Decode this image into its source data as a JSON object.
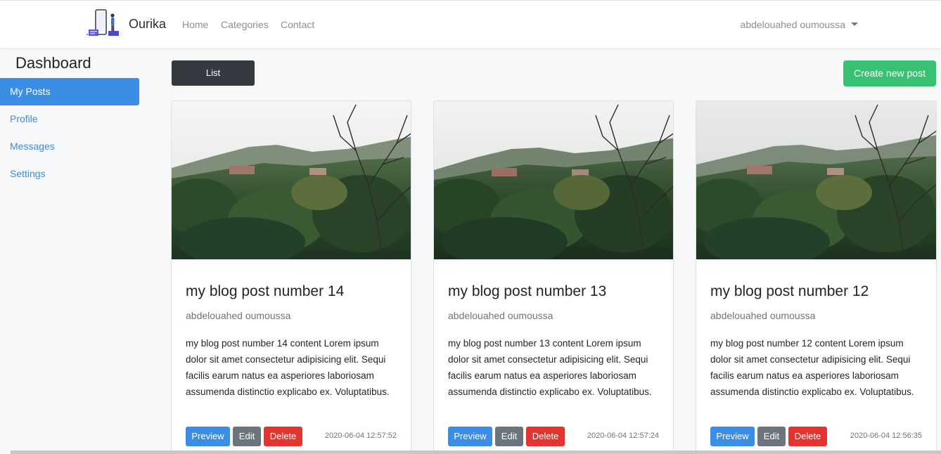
{
  "navbar": {
    "brand": "Ourika",
    "links": [
      "Home",
      "Categories",
      "Contact"
    ],
    "user": "abdelouahed oumoussa"
  },
  "sidebar": {
    "title": "Dashboard",
    "items": [
      {
        "label": "My Posts",
        "active": true
      },
      {
        "label": "Profile",
        "active": false
      },
      {
        "label": "Messages",
        "active": false
      },
      {
        "label": "Settings",
        "active": false
      }
    ]
  },
  "toolbar": {
    "list_label": "List",
    "create_label": "Create new post"
  },
  "posts": [
    {
      "title": "my blog post number 14",
      "author": "abdelouahed oumoussa",
      "content": "my blog post number 14 content Lorem ipsum dolor sit amet consectetur adipisicing elit. Sequi facilis earum natus ea asperiores laboriosam assumenda distinctio explicabo ex. Voluptatibus.",
      "preview_label": "Preview",
      "edit_label": "Edit",
      "delete_label": "Delete",
      "date": "2020-06-04 12:57:52"
    },
    {
      "title": "my blog post number 13",
      "author": "abdelouahed oumoussa",
      "content": "my blog post number 13 content Lorem ipsum dolor sit amet consectetur adipisicing elit. Sequi facilis earum natus ea asperiores laboriosam assumenda distinctio explicabo ex. Voluptatibus.",
      "preview_label": "Preview",
      "edit_label": "Edit",
      "delete_label": "Delete",
      "date": "2020-06-04 12:57:24"
    },
    {
      "title": "my blog post number 12",
      "author": "abdelouahed oumoussa",
      "content": "my blog post number 12 content Lorem ipsum dolor sit amet consectetur adipisicing elit. Sequi facilis earum natus ea asperiores laboriosam assumenda distinctio explicabo ex. Voluptatibus.",
      "preview_label": "Preview",
      "edit_label": "Edit",
      "delete_label": "Delete",
      "date": "2020-06-04 12:56:35"
    }
  ],
  "colors": {
    "primary": "#3a8ee6",
    "success": "#38c172",
    "danger": "#e3342f",
    "secondary": "#6c757d",
    "dark": "#343a40"
  },
  "icons": {
    "logo": "phone-figure-logo-icon",
    "user_dropdown": "caret-down-icon"
  }
}
